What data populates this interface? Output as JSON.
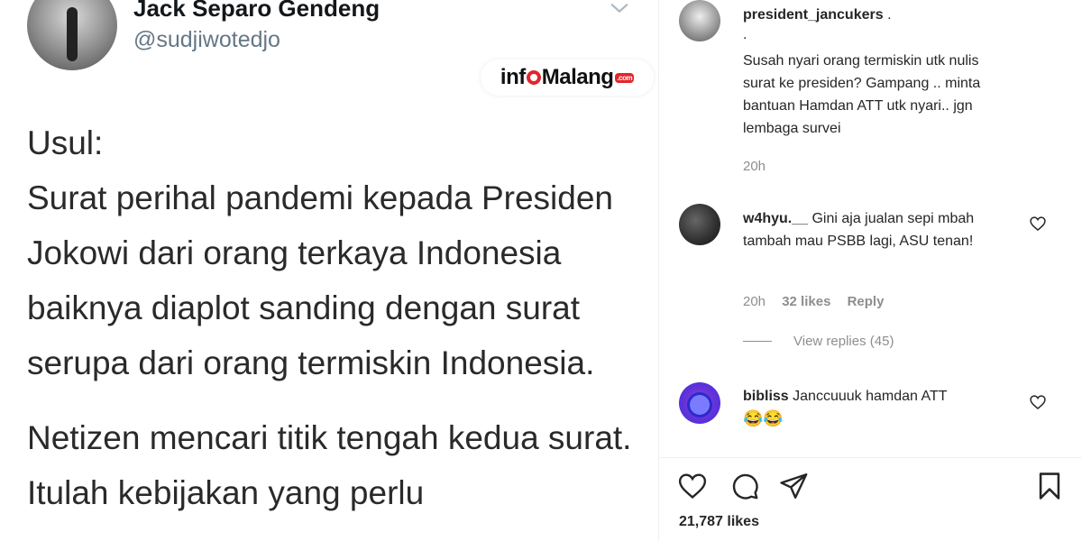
{
  "tweet": {
    "name": "Jack Separo Gendeng",
    "handle": "@sudjiwotedjo",
    "paragraphs": [
      "Usul:\nSurat perihal pandemi kepada Presiden Jokowi dari orang terkaya Indonesia baiknya diaplot sanding dengan surat serupa dari orang termiskin Indonesia.",
      "Netizen mencari titik tengah kedua surat. Itulah kebijakan yang perlu"
    ]
  },
  "watermark": {
    "part1": "inf",
    "part2": "Malang",
    "suffix": ".com"
  },
  "post": {
    "author": "president_jancukers",
    "author_suffix": ".",
    "caption_lines": [
      ".",
      "Susah nyari orang termiskin utk nulis surat ke presiden? Gampang .. minta bantuan Hamdan ATT utk nyari.. jgn lembaga survei"
    ],
    "time": "20h",
    "likes": "21,787 likes"
  },
  "comments": [
    {
      "user": "w4hyu.__",
      "text": "Gini aja jualan sepi mbah tambah mau PSBB lagi, ASU tenan!",
      "time": "20h",
      "likes": "32 likes",
      "reply": "Reply",
      "view_replies": "View replies (45)"
    },
    {
      "user": "bibliss",
      "text": "Janccuuuk hamdan ATT",
      "emoji": "😂😂"
    }
  ],
  "icons": {
    "heart": "heart-icon",
    "comment": "comment-icon",
    "share": "share-icon",
    "bookmark": "bookmark-icon",
    "chevron": "chevron-down-icon"
  }
}
